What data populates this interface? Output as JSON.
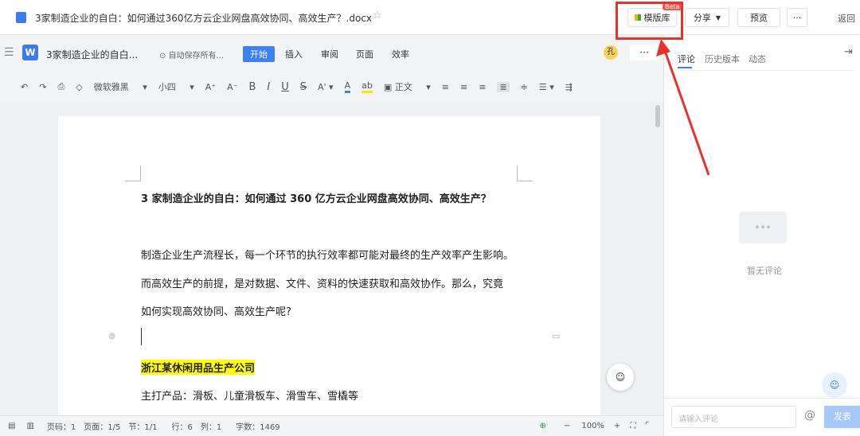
{
  "header": {
    "file_title": "3家制造企业的自白：如何通过360亿方云企业网盘高效协同、高效生产？.docx",
    "template_label": "模版库",
    "beta_badge": "Beta",
    "share_label": "分享",
    "preview_label": "预览",
    "more_label": "···",
    "back_label": "返回"
  },
  "doc_bar": {
    "doc_name": "3家制造企业的自白...",
    "autosave": "自动保存所有...",
    "tabs": [
      "开始",
      "插入",
      "审阅",
      "页面",
      "效率"
    ],
    "avatar": "孔",
    "more": "···"
  },
  "toolbar": {
    "font": "微软雅黑",
    "size": "小四",
    "bold": "B",
    "italic": "I",
    "underline": "U",
    "strike": "S",
    "style": "正文"
  },
  "document": {
    "title": "3 家制造企业的自白：如何通过 360 亿方云企业网盘高效协同、高效生产？",
    "p1": "制造企业生产流程长，每一个环节的执行效率都可能对最终的生产效率产生影响。",
    "p2": "而高效生产的前提，是对数据、文件、资料的快速获取和高效协作。那么，究竟",
    "p3": "如何实现高效协同、高效生产呢?",
    "heading": "浙江某休闲用品生产公司",
    "p4": "主打产品：滑板、儿童滑板车、滑雪车、雪橇等"
  },
  "right_panel": {
    "tabs": [
      "评论",
      "历史版本",
      "动态"
    ],
    "empty": "暂无评论",
    "input_placeholder": "请输入评论",
    "send": "发表"
  },
  "status": {
    "page_no": "页码：1",
    "pages": "页面：1/5",
    "section": "节：1/1",
    "row": "行：6",
    "col": "列：1",
    "words": "字数：1469",
    "zoom": "100%"
  },
  "colors": {
    "accent": "#3c82f6",
    "highlight": "#ffff00",
    "annotation": "#e8322c"
  }
}
